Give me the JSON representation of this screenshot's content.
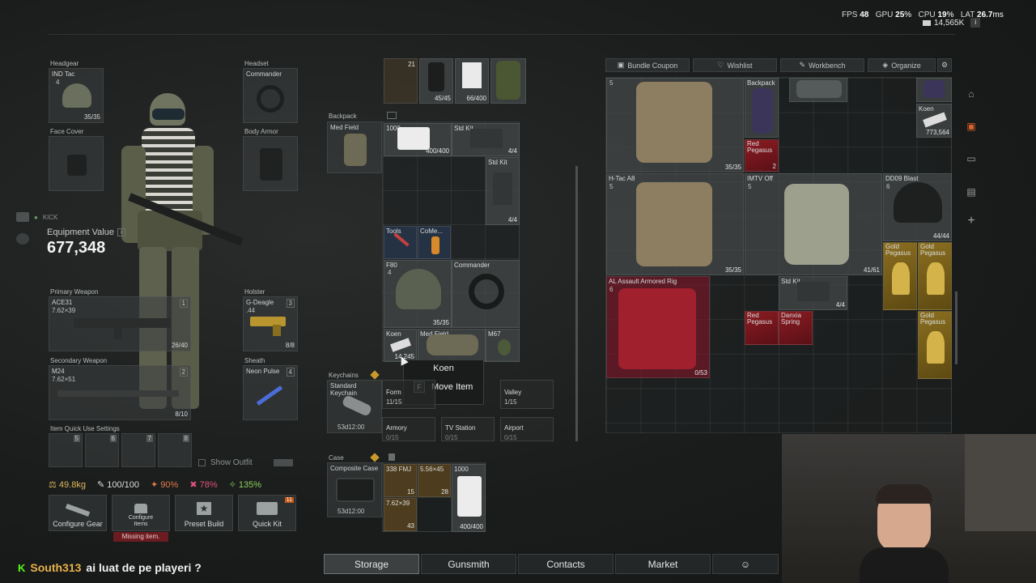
{
  "hud": {
    "fps_label": "FPS",
    "fps": "48",
    "gpu_label": "GPU",
    "gpu": "25",
    "cpu_label": "CPU",
    "cpu": "19",
    "lat_label": "LAT",
    "lat": "26.7",
    "money": "14,565K"
  },
  "equipment": {
    "headgear": {
      "title": "Headgear",
      "item": "IND Tac",
      "count": "4",
      "dur": "35/35"
    },
    "headset": {
      "title": "Headset",
      "item": "Commander"
    },
    "face_cover": {
      "title": "Face Cover"
    },
    "body_armor": {
      "title": "Body Armor"
    },
    "value_label": "Equipment Value",
    "value": "677,348",
    "primary": {
      "title": "Primary Weapon",
      "item": "ACE31",
      "caliber": "7.62×39",
      "slot": "1",
      "ammo": "26/40"
    },
    "secondary": {
      "title": "Secondary Weapon",
      "item": "M24",
      "caliber": "7.62×51",
      "slot": "2",
      "ammo": "8/10"
    },
    "holster": {
      "title": "Holster",
      "item": "G-Deagle",
      "caliber": ".44",
      "slot": "3",
      "ammo": "8/8"
    },
    "sheath": {
      "title": "Sheath",
      "item": "Neon Pulse",
      "slot": "4"
    },
    "quick_use_title": "Item Quick Use Settings",
    "quick_slots": [
      "5",
      "6",
      "7",
      "8"
    ],
    "show_outfit": "Show Outfit",
    "kick": "KICK"
  },
  "stats": {
    "weight": "49.8kg",
    "health": "100/100",
    "stat2": "90%",
    "stat3": "78%",
    "stat4": "135%"
  },
  "actions": [
    {
      "label": "Configure Gear"
    },
    {
      "label": "Configure Items",
      "warning": "Missing item."
    },
    {
      "label": "Preset Build"
    },
    {
      "label": "Quick Kit",
      "badge": "11"
    }
  ],
  "chat": {
    "user": "South313",
    "message": "ai luat de pe playeri ?"
  },
  "backpack": {
    "title": "Backpack",
    "item": "Med Field",
    "top_items": [
      {
        "count": "21"
      },
      {
        "dur": "45/45"
      },
      {
        "dur": "66/400"
      }
    ],
    "items": [
      {
        "name": "1000",
        "dur": "400/400"
      },
      {
        "name": "Std Kit",
        "dur": "4/4"
      },
      {
        "name": "Std Kit",
        "dur": "4/4"
      },
      {
        "name": "Tools"
      },
      {
        "name": "CoMe..."
      },
      {
        "name": "F80",
        "count": "4",
        "dur": "35/35"
      },
      {
        "name": "Commander"
      },
      {
        "name": "Koen",
        "dur": "14,245"
      },
      {
        "name": "Med Field"
      },
      {
        "name": "M67"
      }
    ]
  },
  "tooltip": {
    "title": "Koen",
    "key": "F",
    "action": "Move Item"
  },
  "keychains": {
    "title": "Keychains",
    "item": "Standard Keychain",
    "time": "53d12:00",
    "locations": [
      {
        "name": "Form",
        "count": "11/15"
      },
      {
        "name": "Valley",
        "count": "1/15"
      },
      {
        "name": "Armory",
        "count": "0/15"
      },
      {
        "name": "TV Station",
        "count": "0/15"
      },
      {
        "name": "Airport",
        "count": "0/15"
      }
    ]
  },
  "case": {
    "title": "Case",
    "item": "Composite Case",
    "time": "53d12:00",
    "items": [
      {
        "name": "338 FMJ",
        "count": "15"
      },
      {
        "name": "5.56×45",
        "count": "28"
      },
      {
        "name": "1000",
        "dur": "400/400"
      },
      {
        "name": "7.62×39",
        "count": "43"
      }
    ]
  },
  "storage_tabs": {
    "bundle": "Bundle Coupon",
    "wishlist": "Wishlist",
    "workbench": "Workbench",
    "organize": "Organize"
  },
  "storage": {
    "items": [
      {
        "name": "",
        "count": "5",
        "dur": "35/35"
      },
      {
        "name": "Backpack"
      },
      {
        "name": "Red Pegasus",
        "count": "2"
      },
      {
        "name": "Koen",
        "dur": "773,564"
      },
      {
        "name": "H-Tac A8",
        "count": "5",
        "dur": "35/35"
      },
      {
        "name": "IMTV Off",
        "count": "5",
        "dur": "41/61"
      },
      {
        "name": "DD09 Blast",
        "count": "6",
        "dur": "44/44"
      },
      {
        "name": "Gold Pegasus"
      },
      {
        "name": "Gold Pegasus"
      },
      {
        "name": "AL Assault Armored Rig",
        "count": "6",
        "dur": "0/53"
      },
      {
        "name": "Std Kit",
        "dur": "4/4"
      },
      {
        "name": "Red Pegasus"
      },
      {
        "name": "Danxia Spring"
      },
      {
        "name": "Gold Pegasus"
      }
    ]
  },
  "nav": {
    "storage": "Storage",
    "gunsmith": "Gunsmith",
    "contacts": "Contacts",
    "market": "Market"
  }
}
